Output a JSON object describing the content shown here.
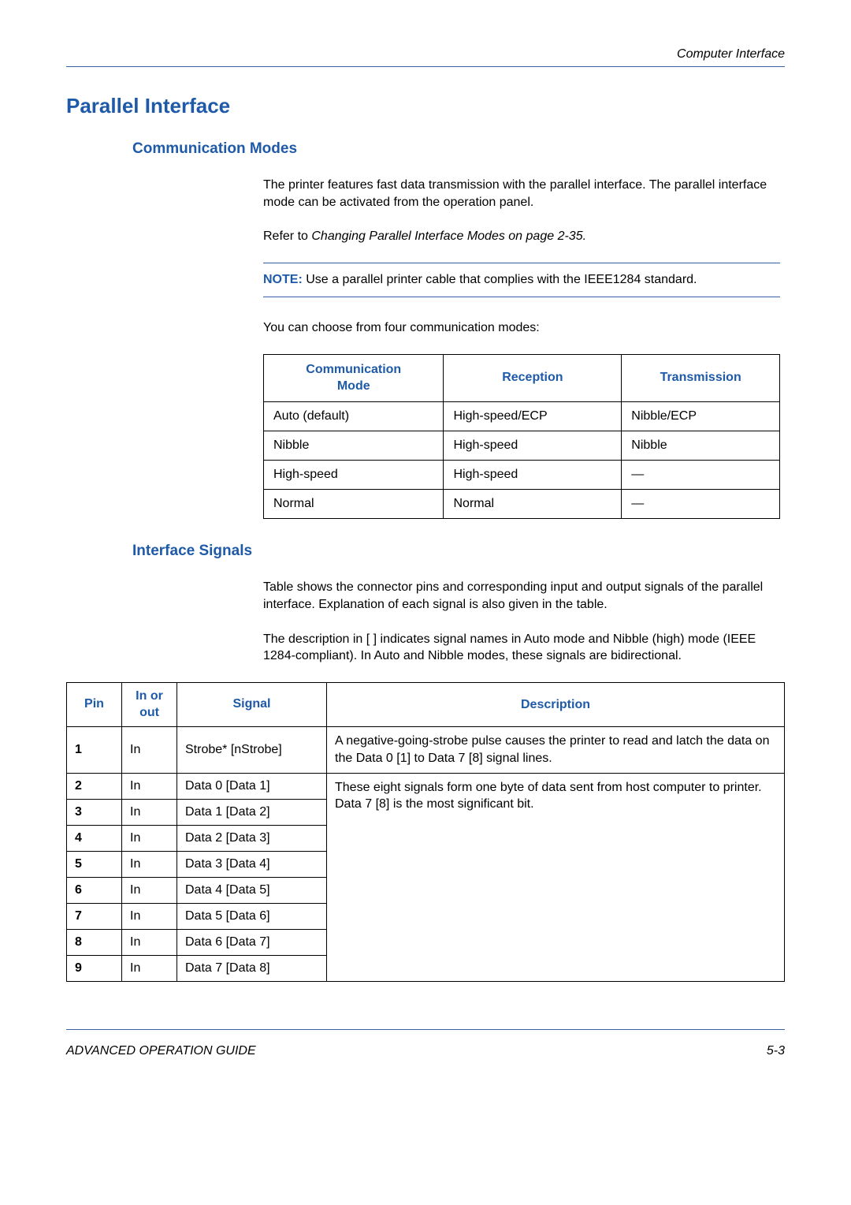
{
  "header": {
    "section_label": "Computer Interface"
  },
  "h1": "Parallel Interface",
  "h2_modes": "Communication Modes",
  "para1": "The printer features fast data transmission with the parallel interface. The parallel interface mode can be activated from the operation panel.",
  "para2_prefix": "Refer to ",
  "para2_emph": "Changing Parallel Interface Modes on page 2-35.",
  "note_label": "NOTE:",
  "note_text": " Use a parallel printer cable that complies with the IEEE1284 standard.",
  "para3": "You can choose from four communication modes:",
  "modes_table": {
    "headers": {
      "col1_line1": "Communication",
      "col1_line2": "Mode",
      "col2": "Reception",
      "col3": "Transmission"
    },
    "rows": [
      {
        "mode": "Auto (default)",
        "reception": "High-speed/ECP",
        "transmission": "Nibble/ECP"
      },
      {
        "mode": "Nibble",
        "reception": "High-speed",
        "transmission": "Nibble"
      },
      {
        "mode": "High-speed",
        "reception": "High-speed",
        "transmission": "—"
      },
      {
        "mode": "Normal",
        "reception": "Normal",
        "transmission": "—"
      }
    ]
  },
  "h2_signals": "Interface Signals",
  "para4": "Table shows the connector pins and corresponding input and output signals of the parallel interface. Explanation of each signal is also given in the table.",
  "para5": "The description in [ ] indicates signal names in Auto mode and Nibble (high) mode (IEEE 1284-compliant). In Auto and Nibble modes, these signals are bidirectional.",
  "signals_table": {
    "headers": {
      "pin": "Pin",
      "io_line1": "In or",
      "io_line2": "out",
      "signal": "Signal",
      "description": "Description"
    },
    "row1": {
      "pin": "1",
      "io": "In",
      "signal": "Strobe* [nStrobe]",
      "desc": "A negative-going-strobe pulse causes the printer to read and latch the data on the Data 0 [1] to Data 7 [8] signal lines."
    },
    "data_desc": "These eight signals form one byte of data sent from host computer to printer. Data 7 [8] is the most significant bit.",
    "data_rows": [
      {
        "pin": "2",
        "io": "In",
        "signal": "Data 0 [Data 1]"
      },
      {
        "pin": "3",
        "io": "In",
        "signal": "Data 1 [Data 2]"
      },
      {
        "pin": "4",
        "io": "In",
        "signal": "Data 2 [Data 3]"
      },
      {
        "pin": "5",
        "io": "In",
        "signal": "Data 3 [Data 4]"
      },
      {
        "pin": "6",
        "io": "In",
        "signal": "Data 4 [Data 5]"
      },
      {
        "pin": "7",
        "io": "In",
        "signal": "Data 5 [Data 6]"
      },
      {
        "pin": "8",
        "io": "In",
        "signal": "Data 6 [Data 7]"
      },
      {
        "pin": "9",
        "io": "In",
        "signal": "Data 7 [Data 8]"
      }
    ]
  },
  "footer": {
    "left": "ADVANCED OPERATION GUIDE",
    "right": "5-3"
  }
}
